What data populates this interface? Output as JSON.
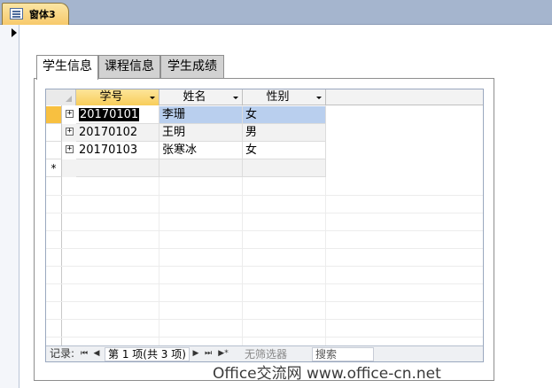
{
  "document_tab": {
    "title": "窗体3",
    "icon": "form-icon"
  },
  "tabs": [
    {
      "label": "学生信息",
      "active": true
    },
    {
      "label": "课程信息",
      "active": false
    },
    {
      "label": "学生成绩",
      "active": false
    }
  ],
  "datasheet": {
    "columns": [
      "学号",
      "姓名",
      "性别"
    ],
    "rows": [
      {
        "id": "20170101",
        "name": "李珊",
        "gender": "女"
      },
      {
        "id": "20170102",
        "name": "王明",
        "gender": "男"
      },
      {
        "id": "20170103",
        "name": "张寒冰",
        "gender": "女"
      }
    ],
    "new_row_marker": "*",
    "expand_glyph": "+"
  },
  "navigation": {
    "label": "记录:",
    "first": "⏮",
    "prev": "◀",
    "position": "第 1 项(共 3 项)",
    "next": "▶",
    "last": "⏭",
    "new": "▶*",
    "filter": "无筛选器",
    "search": "搜索"
  },
  "watermark": "Office交流网 www.office-cn.net"
}
